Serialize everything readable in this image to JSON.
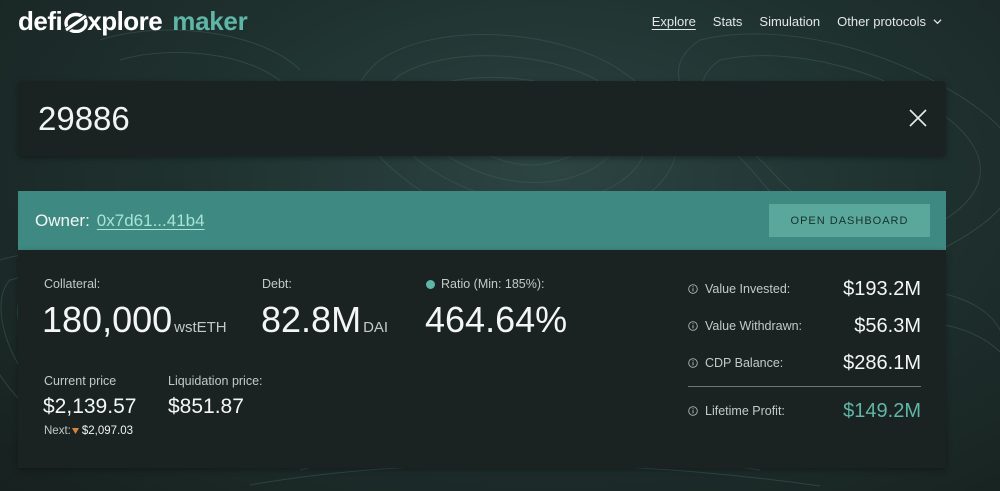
{
  "header": {
    "logo": {
      "part1": "defi",
      "part2": "xplore",
      "brand": "maker"
    },
    "nav": [
      {
        "label": "Explore",
        "active": true
      },
      {
        "label": "Stats",
        "active": false
      },
      {
        "label": "Simulation",
        "active": false
      },
      {
        "label": "Other protocols",
        "active": false,
        "icon": "chevron-down-icon"
      }
    ]
  },
  "search": {
    "value": "29886",
    "clear_icon": "close-icon"
  },
  "owner": {
    "label": "Owner:",
    "address": "0x7d61...41b4",
    "button_label": "OPEN DASHBOARD"
  },
  "vault": {
    "collateral": {
      "label": "Collateral:",
      "value": "180,000",
      "unit": "wstETH"
    },
    "debt": {
      "label": "Debt:",
      "value": "82.8M",
      "unit": "DAI"
    },
    "ratio": {
      "label": "Ratio (Min: 185%):",
      "value": "464.64%",
      "indicator_color": "#5fb6a7"
    },
    "current_price": {
      "label": "Current price",
      "value": "$2,139.57",
      "next_label": "Next:",
      "next_value": "$2,097.03",
      "next_direction": "down"
    },
    "liquidation_price": {
      "label": "Liquidation price:",
      "value": "$851.87"
    }
  },
  "stats": [
    {
      "label": "Value Invested:",
      "value": "$193.2M"
    },
    {
      "label": "Value Withdrawn:",
      "value": "$56.3M"
    },
    {
      "label": "CDP Balance:",
      "value": "$286.1M"
    },
    {
      "label": "Lifetime Profit:",
      "value": "$149.2M",
      "highlight": true
    }
  ],
  "colors": {
    "accent": "#5fb6a7",
    "owner_bar": "#3e8a82",
    "panel": "#1b2322",
    "next_arrow": "#d9853b"
  }
}
